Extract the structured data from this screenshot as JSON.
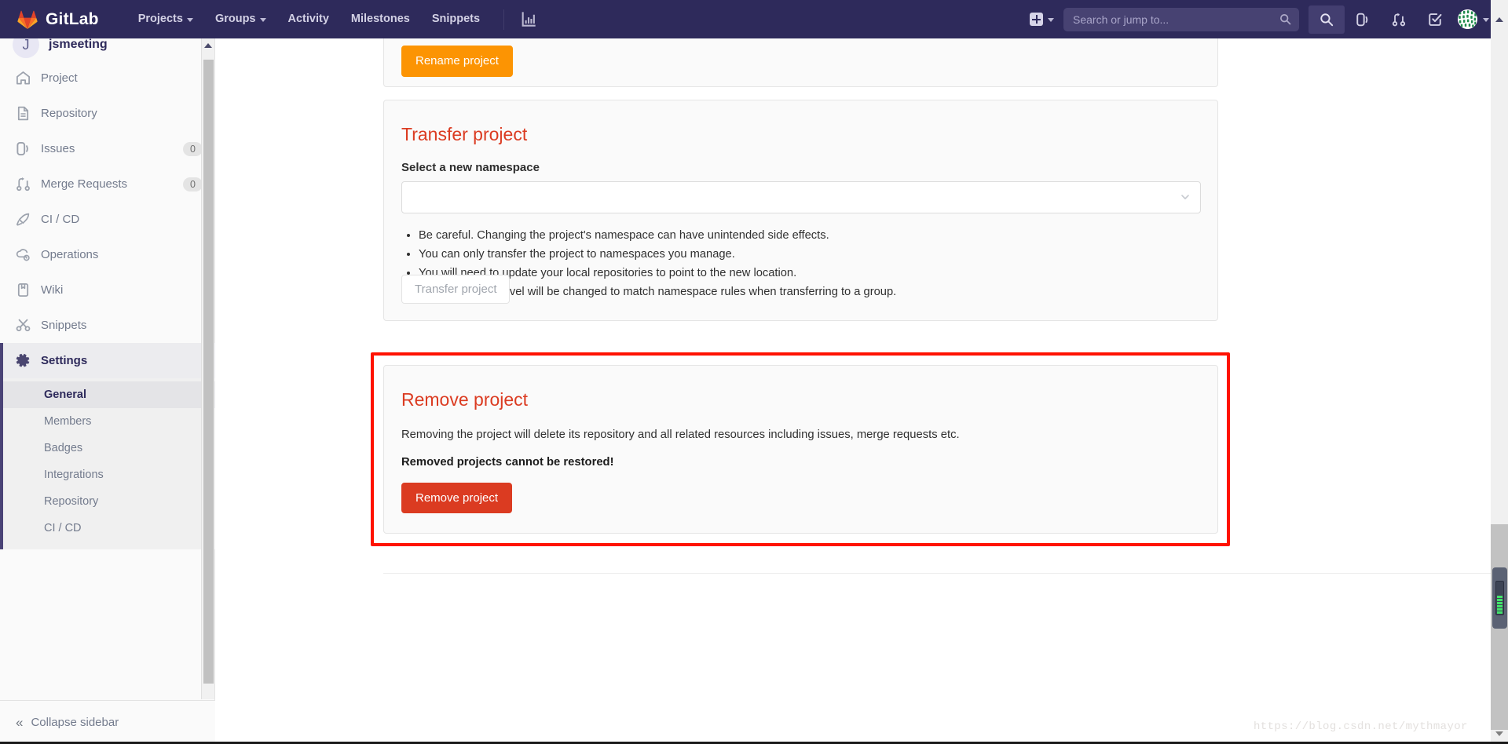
{
  "navbar": {
    "brand": "GitLab",
    "brand_icon": "gitlab-logo-icon",
    "links": [
      {
        "label": "Projects",
        "has_caret": true,
        "name": "nav-projects"
      },
      {
        "label": "Groups",
        "has_caret": true,
        "name": "nav-groups"
      },
      {
        "label": "Activity",
        "has_caret": false,
        "name": "nav-activity"
      },
      {
        "label": "Milestones",
        "has_caret": false,
        "name": "nav-milestones"
      },
      {
        "label": "Snippets",
        "has_caret": false,
        "name": "nav-snippets"
      }
    ],
    "analytics_icon": "chart-icon",
    "create_new_icon": "plus-square-icon",
    "search": {
      "placeholder": "Search or jump to...",
      "value": "",
      "icon": "search-icon"
    },
    "right_icons": [
      {
        "name": "issues-icon",
        "title": "Issues"
      },
      {
        "name": "merge-requests-icon",
        "title": "Merge requests"
      },
      {
        "name": "todos-icon",
        "title": "To-Do List"
      }
    ],
    "avatar_icon": "user-avatar",
    "avatar_caret_icon": "chevron-down-icon",
    "background": "#2e2a5b"
  },
  "sidebar": {
    "project": {
      "name": "jsmeeting",
      "initial": "J"
    },
    "items": [
      {
        "label": "Project",
        "icon": "home-icon",
        "badge": null
      },
      {
        "label": "Repository",
        "icon": "document-icon",
        "badge": null
      },
      {
        "label": "Issues",
        "icon": "issues-icon",
        "badge": "0"
      },
      {
        "label": "Merge Requests",
        "icon": "merge-requests-icon",
        "badge": "0"
      },
      {
        "label": "CI / CD",
        "icon": "rocket-icon",
        "badge": null
      },
      {
        "label": "Operations",
        "icon": "cloud-gear-icon",
        "badge": null
      },
      {
        "label": "Wiki",
        "icon": "book-icon",
        "badge": null
      },
      {
        "label": "Snippets",
        "icon": "scissors-icon",
        "badge": null
      }
    ],
    "settings": {
      "label": "Settings",
      "icon": "gear-icon",
      "active": true
    },
    "settings_subitems": [
      {
        "label": "General",
        "active": true
      },
      {
        "label": "Members",
        "active": false
      },
      {
        "label": "Badges",
        "active": false
      },
      {
        "label": "Integrations",
        "active": false
      },
      {
        "label": "Repository",
        "active": false
      },
      {
        "label": "CI / CD",
        "active": false
      }
    ],
    "collapse": {
      "label": "Collapse sidebar",
      "icon": "double-chevron-left-icon"
    }
  },
  "main": {
    "rename_section": {
      "button_label": "Rename project"
    },
    "transfer_section": {
      "title": "Transfer project",
      "field_label": "Select a new namespace",
      "select_value": "",
      "select_icon": "chevron-down-icon",
      "hints": [
        "Be careful. Changing the project's namespace can have unintended side effects.",
        "You can only transfer the project to namespaces you manage.",
        "You will need to update your local repositories to point to the new location.",
        "Project visibility level will be changed to match namespace rules when transferring to a group."
      ],
      "button_label": "Transfer project",
      "button_disabled": true
    },
    "remove_section": {
      "title": "Remove project",
      "description": "Removing the project will delete its repository and all related resources including issues, merge requests etc.",
      "warning": "Removed projects cannot be restored!",
      "button_label": "Remove project",
      "highlight_color": "#ff1200"
    }
  },
  "watermark": {
    "text": "https://blog.csdn.net/mythmayor"
  },
  "colors": {
    "navbar_bg": "#2e2a5b",
    "danger": "#db3b21",
    "warning": "#fc9403",
    "highlight": "#ff1200",
    "sidebar_bg": "#fafafa"
  }
}
